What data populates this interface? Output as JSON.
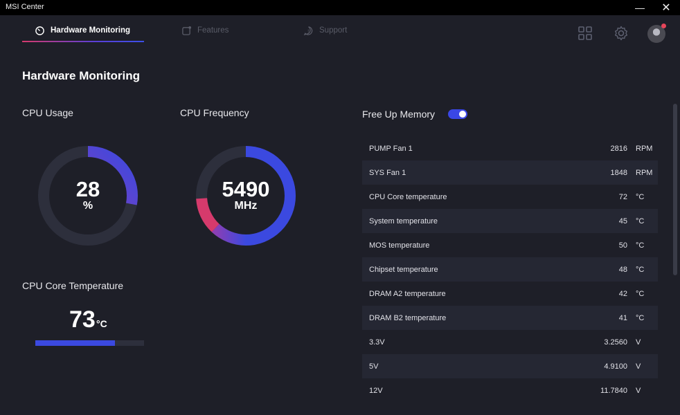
{
  "window": {
    "title": "MSI Center",
    "minimize_glyph": "—",
    "close_glyph": "✕"
  },
  "nav": {
    "tabs": [
      {
        "label": "Hardware Monitoring",
        "icon": "gauge-icon",
        "active": true
      },
      {
        "label": "Features",
        "icon": "features-icon",
        "active": false
      },
      {
        "label": "Support",
        "icon": "support-icon",
        "active": false
      }
    ],
    "right_icons": [
      "grid-icon",
      "gear-icon",
      "avatar"
    ]
  },
  "page": {
    "title": "Hardware Monitoring"
  },
  "cpu_usage": {
    "label": "CPU Usage",
    "value": "28",
    "unit": "%",
    "fraction": 0.28
  },
  "cpu_frequency": {
    "label": "CPU Frequency",
    "value": "5490",
    "unit": "MHz",
    "fraction": 0.74
  },
  "cpu_core_temp": {
    "label": "CPU Core Temperature",
    "value": "73",
    "unit": "°C",
    "fraction": 0.73
  },
  "free_memory": {
    "label": "Free Up Memory",
    "enabled": true
  },
  "sensors": [
    {
      "name": "PUMP Fan 1",
      "value": "2816",
      "unit": "RPM"
    },
    {
      "name": "SYS Fan 1",
      "value": "1848",
      "unit": "RPM"
    },
    {
      "name": "CPU Core temperature",
      "value": "72",
      "unit": "°C"
    },
    {
      "name": "System temperature",
      "value": "45",
      "unit": "°C"
    },
    {
      "name": "MOS temperature",
      "value": "50",
      "unit": "°C"
    },
    {
      "name": "Chipset temperature",
      "value": "48",
      "unit": "°C"
    },
    {
      "name": "DRAM A2 temperature",
      "value": "42",
      "unit": "°C"
    },
    {
      "name": "DRAM B2 temperature",
      "value": "41",
      "unit": "°C"
    },
    {
      "name": "3.3V",
      "value": "3.2560",
      "unit": "V"
    },
    {
      "name": "5V",
      "value": "4.9100",
      "unit": "V"
    },
    {
      "name": "12V",
      "value": "11.7840",
      "unit": "V"
    }
  ],
  "colors": {
    "accent": "#3b49e0",
    "accent_pink": "#d63a6c",
    "background": "#1e1f28",
    "track": "#2d2f3c"
  }
}
